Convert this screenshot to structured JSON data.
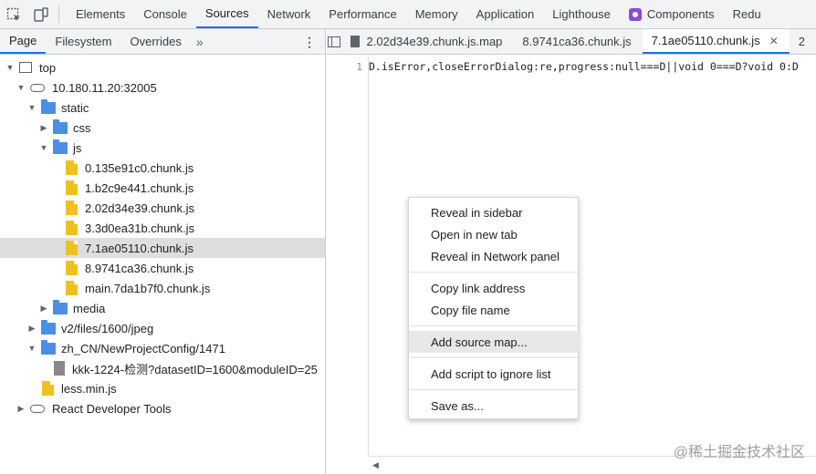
{
  "toolbar": {
    "tabs": [
      "Elements",
      "Console",
      "Sources",
      "Network",
      "Performance",
      "Memory",
      "Application",
      "Lighthouse",
      "Components",
      "Redu"
    ],
    "active": "Sources"
  },
  "navigator": {
    "tabs": [
      "Page",
      "Filesystem",
      "Overrides"
    ],
    "more": "»",
    "menu": "⋮"
  },
  "tree": [
    {
      "label": "top"
    },
    {
      "label": "10.180.11.20:32005"
    },
    {
      "label": "static"
    },
    {
      "label": "css"
    },
    {
      "label": "js"
    },
    {
      "label": "0.135e91c0.chunk.js"
    },
    {
      "label": "1.b2c9e441.chunk.js"
    },
    {
      "label": "2.02d34e39.chunk.js"
    },
    {
      "label": "3.3d0ea31b.chunk.js"
    },
    {
      "label": "7.1ae05110.chunk.js",
      "selected": true
    },
    {
      "label": "8.9741ca36.chunk.js"
    },
    {
      "label": "main.7da1b7f0.chunk.js"
    },
    {
      "label": "media"
    },
    {
      "label": "v2/files/1600/jpeg"
    },
    {
      "label": "zh_CN/NewProjectConfig/1471"
    },
    {
      "label": "kkk-1224-检测?datasetID=1600&moduleID=25"
    },
    {
      "label": "less.min.js"
    },
    {
      "label": "React Developer Tools"
    }
  ],
  "editor": {
    "tabs": [
      "2.02d34e39.chunk.js.map",
      "8.9741ca36.chunk.js",
      "7.1ae05110.chunk.js",
      "2"
    ],
    "active_tab": "7.1ae05110.chunk.js",
    "line_number": "1",
    "code": "D.isError,closeErrorDialog:re,progress:null===D||void 0===D?void 0:D"
  },
  "context_menu": {
    "items": [
      "Reveal in sidebar",
      "Open in new tab",
      "Reveal in Network panel",
      "Copy link address",
      "Copy file name",
      "Add source map...",
      "Add script to ignore list",
      "Save as..."
    ],
    "highlighted": "Add source map..."
  },
  "watermark": "@稀土掘金技术社区"
}
